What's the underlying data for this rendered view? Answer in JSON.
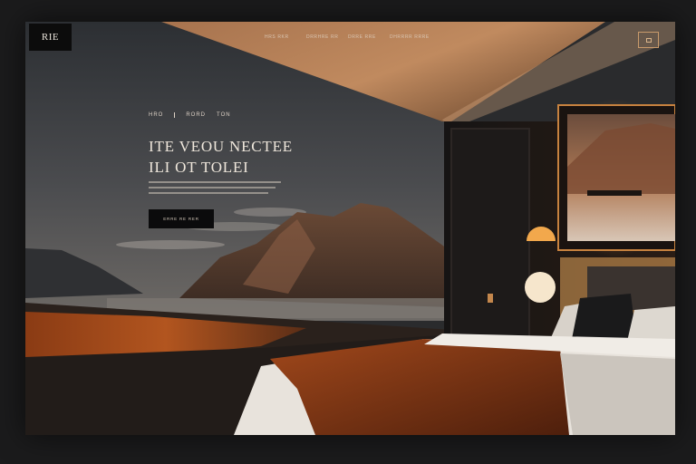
{
  "brand": {
    "logo_text": "RIE"
  },
  "nav": {
    "items": [
      {
        "label": "HRS  RKR"
      },
      {
        "label": "DRRHRE  RR"
      },
      {
        "label": "DRRE  RRE"
      },
      {
        "label": "DHRRRR  RRRE"
      }
    ]
  },
  "hero": {
    "eyebrow": [
      "HRO",
      "RORD",
      "TON"
    ],
    "headline_line1": "ITE VEOU NECTEE",
    "headline_line2": "ILI OT TOLEI",
    "cta_label": "ERRE RE RER"
  },
  "colors": {
    "accent": "#c8804a",
    "background": "#1b1b1c",
    "headline": "#efe7dc"
  }
}
